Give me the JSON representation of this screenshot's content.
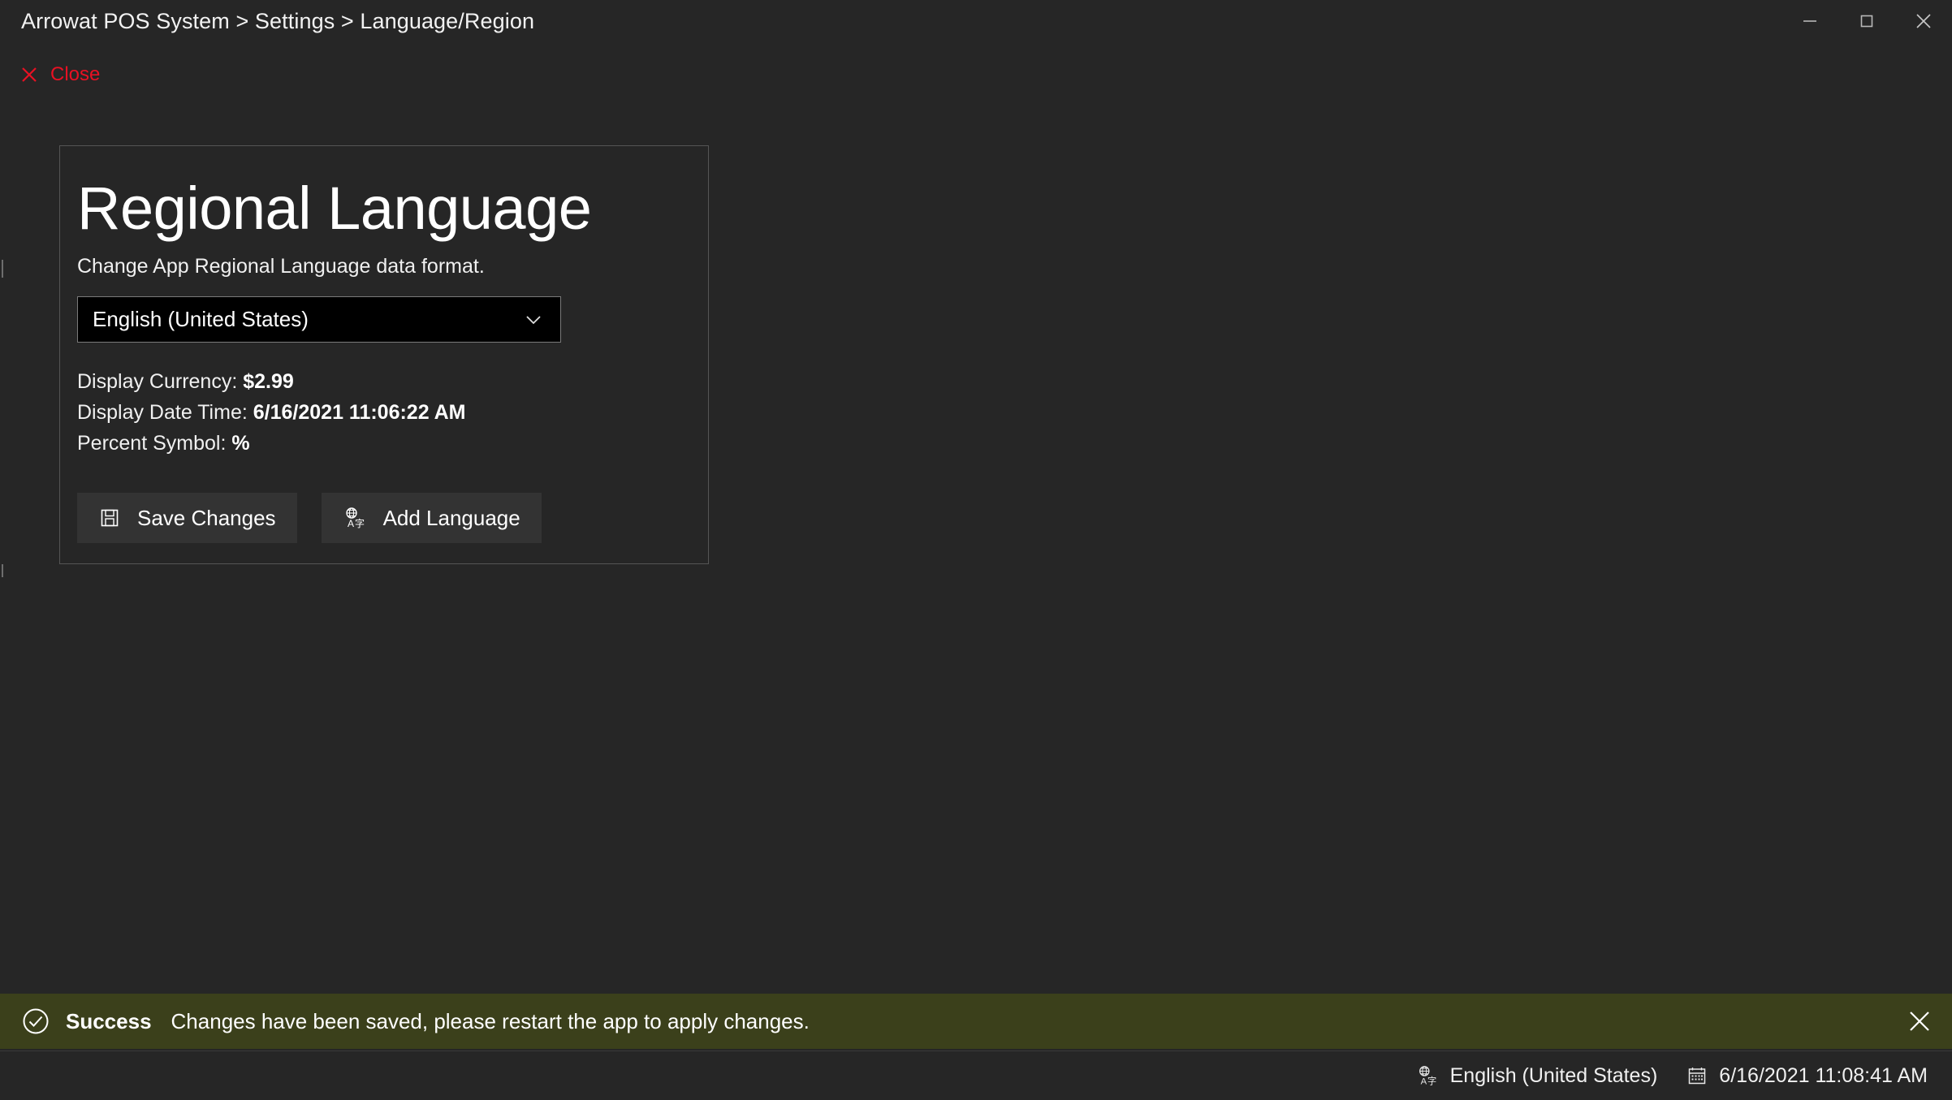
{
  "window": {
    "breadcrumb": "Arrowat POS System > Settings > Language/Region",
    "controls": {
      "minimize": "minimize-icon",
      "maximize": "maximize-icon",
      "close": "close-icon"
    }
  },
  "commandbar": {
    "close_label": "Close",
    "close_icon": "close-x-icon",
    "close_color": "#e81123"
  },
  "card": {
    "title": "Regional Language",
    "subtitle": "Change App Regional Language data format.",
    "language_select": {
      "value": "English (United States)",
      "chevron_icon": "chevron-down-icon"
    },
    "info": [
      {
        "label": "Display Currency: ",
        "value": "$2.99"
      },
      {
        "label": "Display Date Time: ",
        "value": "6/16/2021 11:06:22 AM"
      },
      {
        "label": "Percent Symbol: ",
        "value": "%"
      }
    ],
    "buttons": {
      "save": {
        "label": "Save Changes",
        "icon": "save-floppy-icon"
      },
      "add": {
        "label": "Add Language",
        "icon": "language-globe-icon"
      }
    }
  },
  "notification": {
    "type": "success",
    "title": "Success",
    "message": "Changes have been saved, please restart the app to apply changes.",
    "icon": "check-circle-icon",
    "close_icon": "close-x-icon",
    "background_color": "#3b401b"
  },
  "statusbar": {
    "language": {
      "icon": "language-globe-icon",
      "text": "English (United States)"
    },
    "datetime": {
      "icon": "calendar-icon",
      "text": "6/16/2021 11:08:41 AM"
    }
  }
}
